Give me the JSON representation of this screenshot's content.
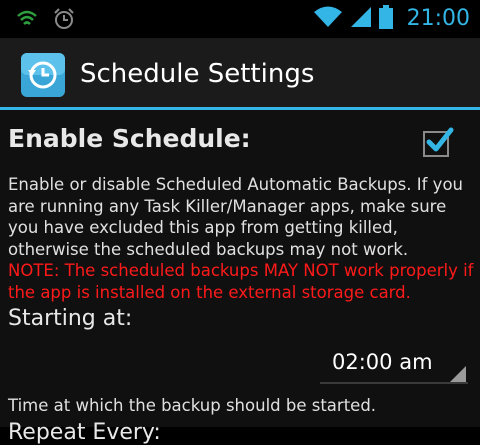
{
  "status_bar": {
    "icons": [
      "shield-icon",
      "alarm-clock-icon",
      "wifi-icon",
      "cell-signal-icon",
      "battery-icon"
    ],
    "time": "21:00",
    "accent_color": "#33b5e5"
  },
  "action_bar": {
    "title": "Schedule Settings",
    "icon": "backup-schedule-icon"
  },
  "enable_schedule": {
    "label": "Enable Schedule:",
    "checked": true,
    "description": "Enable or disable Scheduled Automatic Backups. If you are running any Task Killer/Manager apps, make sure you have excluded this app from getting killed, otherwise the scheduled backups may not work.",
    "note": "NOTE: The scheduled backups MAY NOT work properly if the app is installed on the external storage card.",
    "note_color": "#ff1a1a"
  },
  "starting_at": {
    "label": "Starting at:",
    "value": "02:00 am",
    "helper": "Time at which the backup should be started."
  },
  "repeat": {
    "label": "Repeat Every:"
  }
}
